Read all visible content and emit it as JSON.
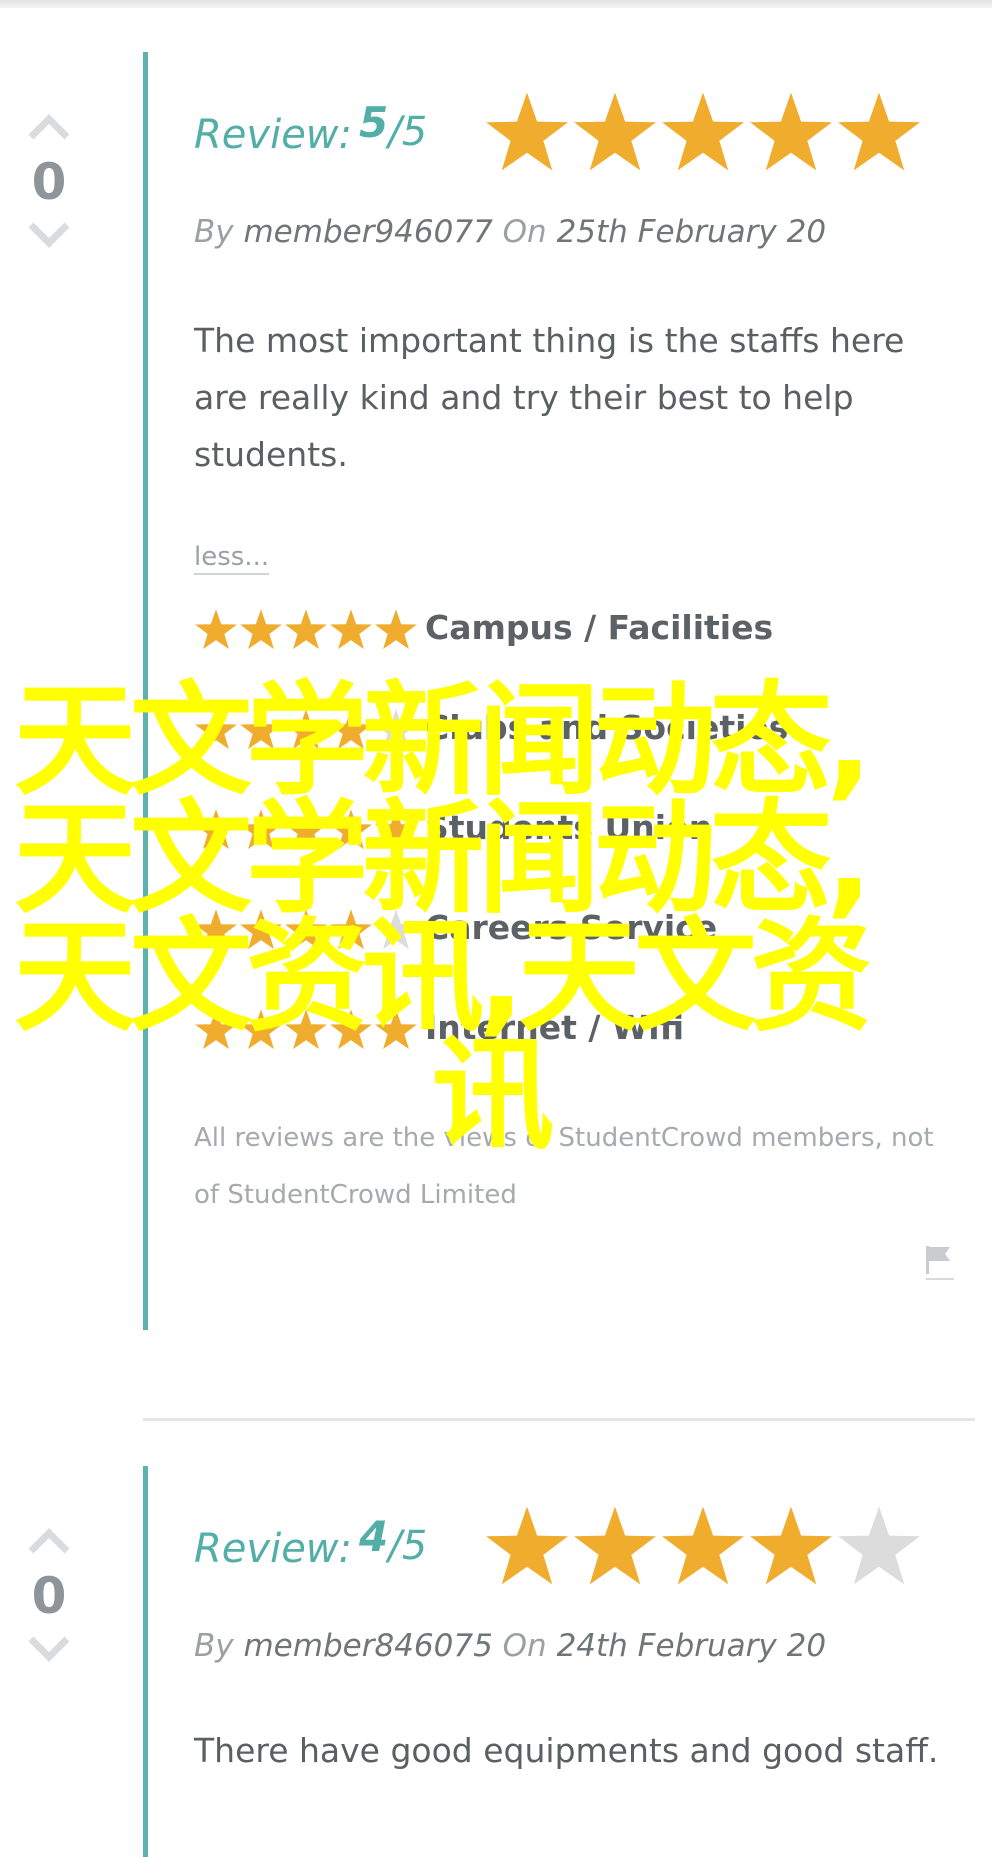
{
  "reviews": [
    {
      "vote_count": "0",
      "review_label": "Review:",
      "score": "5",
      "score_max": "/5",
      "rating": 5,
      "by_label": "By",
      "author": "member946077",
      "on_label": "On",
      "date": "25th February 20",
      "text": "The most important thing is the staffs here are really kind and try their best to help students.",
      "less_link": "less...",
      "categories": [
        {
          "label": "Campus / Facilities",
          "rating": 5
        },
        {
          "label": "Clubs and Societies",
          "rating": 4
        },
        {
          "label": "Students Union",
          "rating": 5
        },
        {
          "label": "Careers Service",
          "rating": 4
        },
        {
          "label": "Internet / Wifi",
          "rating": 5
        }
      ],
      "disclaimer": "All reviews are the views of StudentCrowd members, not of StudentCrowd Limited"
    },
    {
      "vote_count": "0",
      "review_label": "Review:",
      "score": "4",
      "score_max": "/5",
      "rating": 4,
      "by_label": "By",
      "author": "member846075",
      "on_label": "On",
      "date": "24th February 20",
      "text": "There have good equipments and good staff."
    }
  ],
  "overlay": {
    "lines": [
      "天文学新闻动态,",
      "天文学新闻动态,",
      "天文资讯,天文资",
      "讯"
    ]
  },
  "colors": {
    "accent": "#52aea6",
    "star_on": "#f0ac2c",
    "star_off": "#dcdcdc",
    "overlay": "#ffff00"
  },
  "icons": {
    "vote_up": "chevron-up-icon",
    "vote_down": "chevron-down-icon",
    "flag": "flag-icon",
    "star": "star-icon"
  }
}
